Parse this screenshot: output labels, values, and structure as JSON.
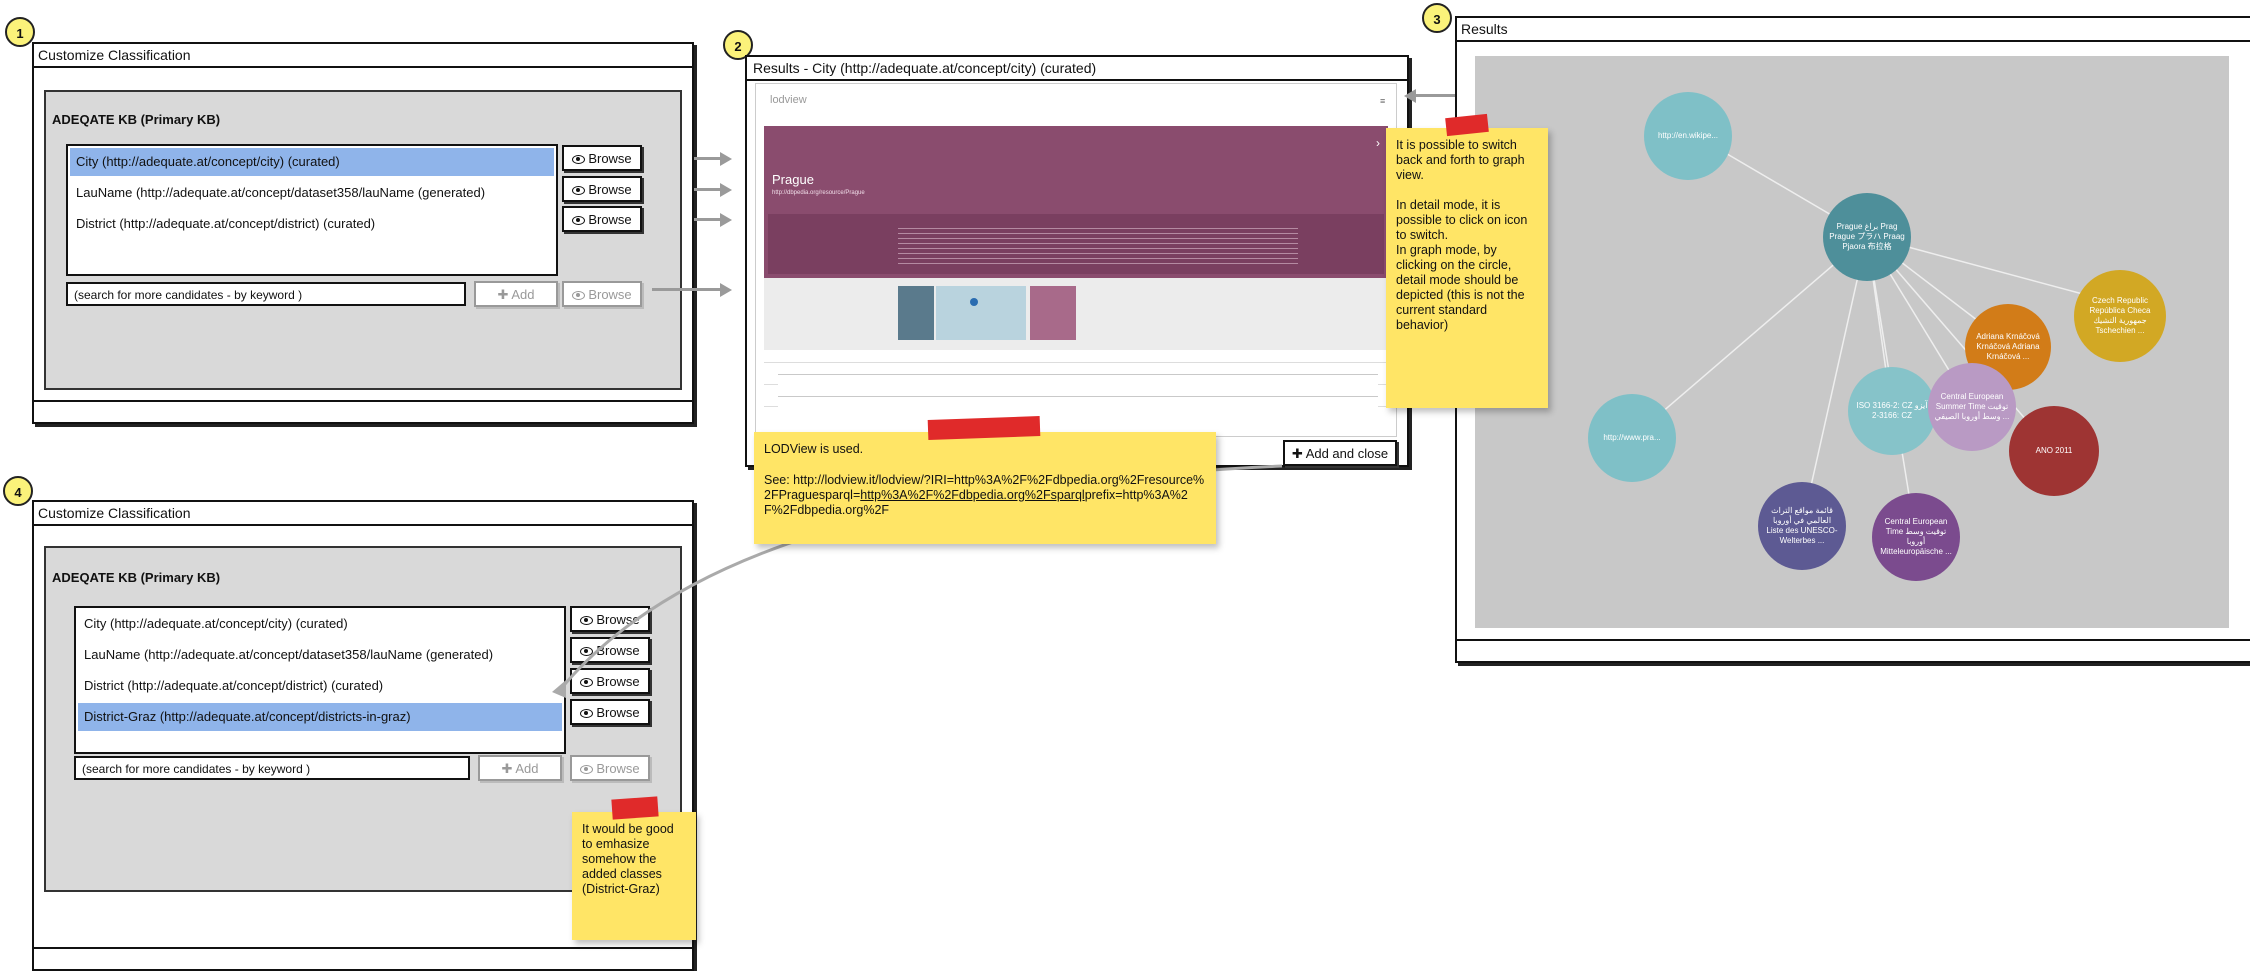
{
  "badges": [
    "1",
    "2",
    "3",
    "4"
  ],
  "frame1": {
    "title": "Customize Classification",
    "kb_title": "ADEQATE KB (Primary KB)",
    "items": [
      "City (http://adequate.at/concept/city) (curated)",
      "LauName (http://adequate.at/concept/dataset358/lauName (generated)",
      "District (http://adequate.at/concept/district) (curated)"
    ],
    "browse_label": "Browse",
    "search_placeholder": "(search for more candidates - by keyword )",
    "add_label": "Add"
  },
  "frame2": {
    "title": "Results - City (http://adequate.at/concept/city) (curated)",
    "logo": "lodview",
    "resource_title": "Prague",
    "resource_iri": "http://dbpedia.org/resource/Prague",
    "add_close_label": "Add and close"
  },
  "frame3": {
    "title": "Results",
    "nodes": [
      "http://en.wikipe...",
      "Prague براغ Prag Prague プラハ Praag Pjaora 布拉格",
      "Czech Republic República Checa جمهورية التشيك Tschechien ...",
      "Adriana Krnáčová Krnáčová Adriana Krnáčová ...",
      "ISO 3166-2: CZ آيزو 3166-2: CZ",
      "Central European Summer Time توقيت وسط أوروبا الصيفي ...",
      "ANO 2011",
      "http://www.pra...",
      "قائمة مواقع التراث العالمي في أوروبا Liste des UNESCO-Welterbes ...",
      "Central European Time توقيت وسط أوروبا Mitteleuropäische ..."
    ]
  },
  "frame4": {
    "title": "Customize Classification",
    "kb_title": "ADEQATE KB (Primary KB)",
    "items": [
      "City (http://adequate.at/concept/city) (curated)",
      "LauName (http://adequate.at/concept/dataset358/lauName (generated)",
      "District (http://adequate.at/concept/district) (curated)",
      "District-Graz (http://adequate.at/concept/districts-in-graz)"
    ],
    "browse_label": "Browse",
    "search_placeholder": "(search for more candidates - by keyword )",
    "add_label": "Add"
  },
  "notes": {
    "graph_switch": "It is possible to switch back and forth to graph view.\n\nIn detail mode, it is possible to click on icon to switch.\nIn graph mode, by clicking on the circle, detail mode should be depicted (this is not the current standard behavior)",
    "lodview_line1": "LODView is used.",
    "lodview_line2_prefix": "See: http://lodview.it/lodview/?IRI=http%3A%2F%2Fdbpedia.org%2Fresource%2FPraguesparql=",
    "lodview_link": "http%3A%2F%2Fdbpedia.org%2Fsparql",
    "lodview_line2_suffix": "prefix=http%3A%2F%2Fdbpedia.org%2F",
    "emphasize": "It would be good to emhasize somehow the added classes (District-Graz)"
  },
  "colors": {
    "selection": "#8fb4ea",
    "sticky": "#ffe566",
    "tape": "#e02a2a",
    "graph_bg": "#c8c8c8",
    "lod_header": "#8a4c6e"
  }
}
